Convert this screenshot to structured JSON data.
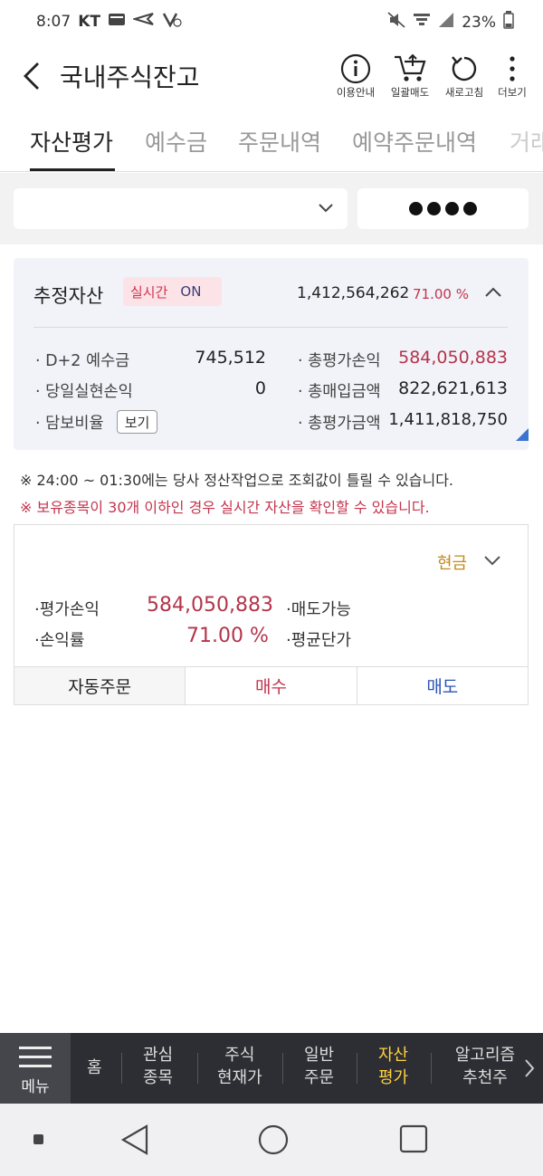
{
  "status_bar": {
    "time": "8:07",
    "carrier": "KT",
    "battery": "23%"
  },
  "header": {
    "title": "국내주식잔고",
    "buttons": [
      {
        "label": "이용안내",
        "icon": "info-icon"
      },
      {
        "label": "일괄매도",
        "icon": "cart-icon"
      },
      {
        "label": "새로고침",
        "icon": "refresh-icon"
      },
      {
        "label": "더보기",
        "icon": "more-icon"
      }
    ]
  },
  "tabs": [
    "자산평가",
    "예수금",
    "주문내역",
    "예약주문내역",
    "거래"
  ],
  "active_tab": "자산평가",
  "asset": {
    "title": "추정자산",
    "realtime_label": "실시간",
    "realtime_state": "ON",
    "total": "1,412,564,262",
    "rate": "71.00 %",
    "rows": [
      {
        "label": "D+2 예수금",
        "value": "745,512"
      },
      {
        "label": "당일실현손익",
        "value": "0"
      },
      {
        "label": "담보비율",
        "button": "보기"
      },
      {
        "label": "총평가손익",
        "value": "584,050,883"
      },
      {
        "label": "총매입금액",
        "value": "822,621,613"
      },
      {
        "label": "총평가금액",
        "value": "1,411,818,750"
      }
    ]
  },
  "notices": [
    "※ 24:00 ~ 01:30에는 당사 정산작업으로 조회값이 틀릴 수 있습니다.",
    "※ 보유종목이 30개 이하인 경우 실시간 자산을 확인할 수 있습니다."
  ],
  "holding": {
    "type": "현금",
    "eval_pl_label": "·평가손익",
    "eval_pl": "584,050,883",
    "sellable_label": "·매도가능",
    "rate_label": "·손익률",
    "rate": "71.00 %",
    "avg_label": "·평균단가",
    "actions": [
      "자동주문",
      "매수",
      "매도"
    ]
  },
  "bottom_nav": {
    "menu_label": "메뉴",
    "items": [
      {
        "line1": "홈",
        "line2": ""
      },
      {
        "line1": "관심",
        "line2": "종목"
      },
      {
        "line1": "주식",
        "line2": "현재가"
      },
      {
        "line1": "일반",
        "line2": "주문"
      },
      {
        "line1": "자산",
        "line2": "평가"
      },
      {
        "line1": "알고리즘",
        "line2": "추천주"
      }
    ]
  },
  "colors": {
    "accent_red": "#b4344b",
    "accent_blue": "#2a55b5",
    "active_nav": "#ffd33d",
    "cash_gold": "#c08a1c"
  }
}
